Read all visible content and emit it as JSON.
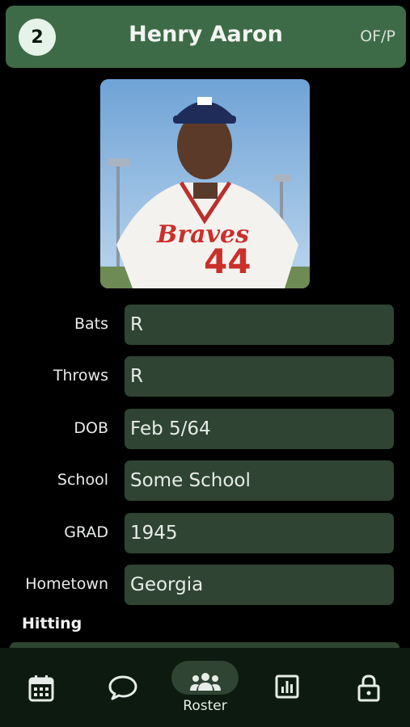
{
  "header": {
    "number": "2",
    "name": "Henry Aaron",
    "position": "OF/P"
  },
  "photo": {
    "jersey_text": "Braves",
    "jersey_number": "44"
  },
  "profile": {
    "fields": [
      {
        "label": "Bats",
        "value": "R"
      },
      {
        "label": "Throws",
        "value": "R"
      },
      {
        "label": "DOB",
        "value": "Feb 5/64"
      },
      {
        "label": "School",
        "value": "Some School"
      },
      {
        "label": "GRAD",
        "value": "1945"
      },
      {
        "label": "Hometown",
        "value": "Georgia"
      }
    ]
  },
  "sections": {
    "hitting_title": "Hitting"
  },
  "nav": {
    "items": [
      {
        "icon": "calendar-icon"
      },
      {
        "icon": "chat-icon"
      },
      {
        "icon": "roster-icon",
        "label": "Roster",
        "active": true
      },
      {
        "icon": "stats-icon"
      },
      {
        "icon": "lock-icon"
      }
    ]
  },
  "colors": {
    "accent": "#3d6b47",
    "field_bg": "#2f4432",
    "nav_bg": "#0c1a0f"
  }
}
